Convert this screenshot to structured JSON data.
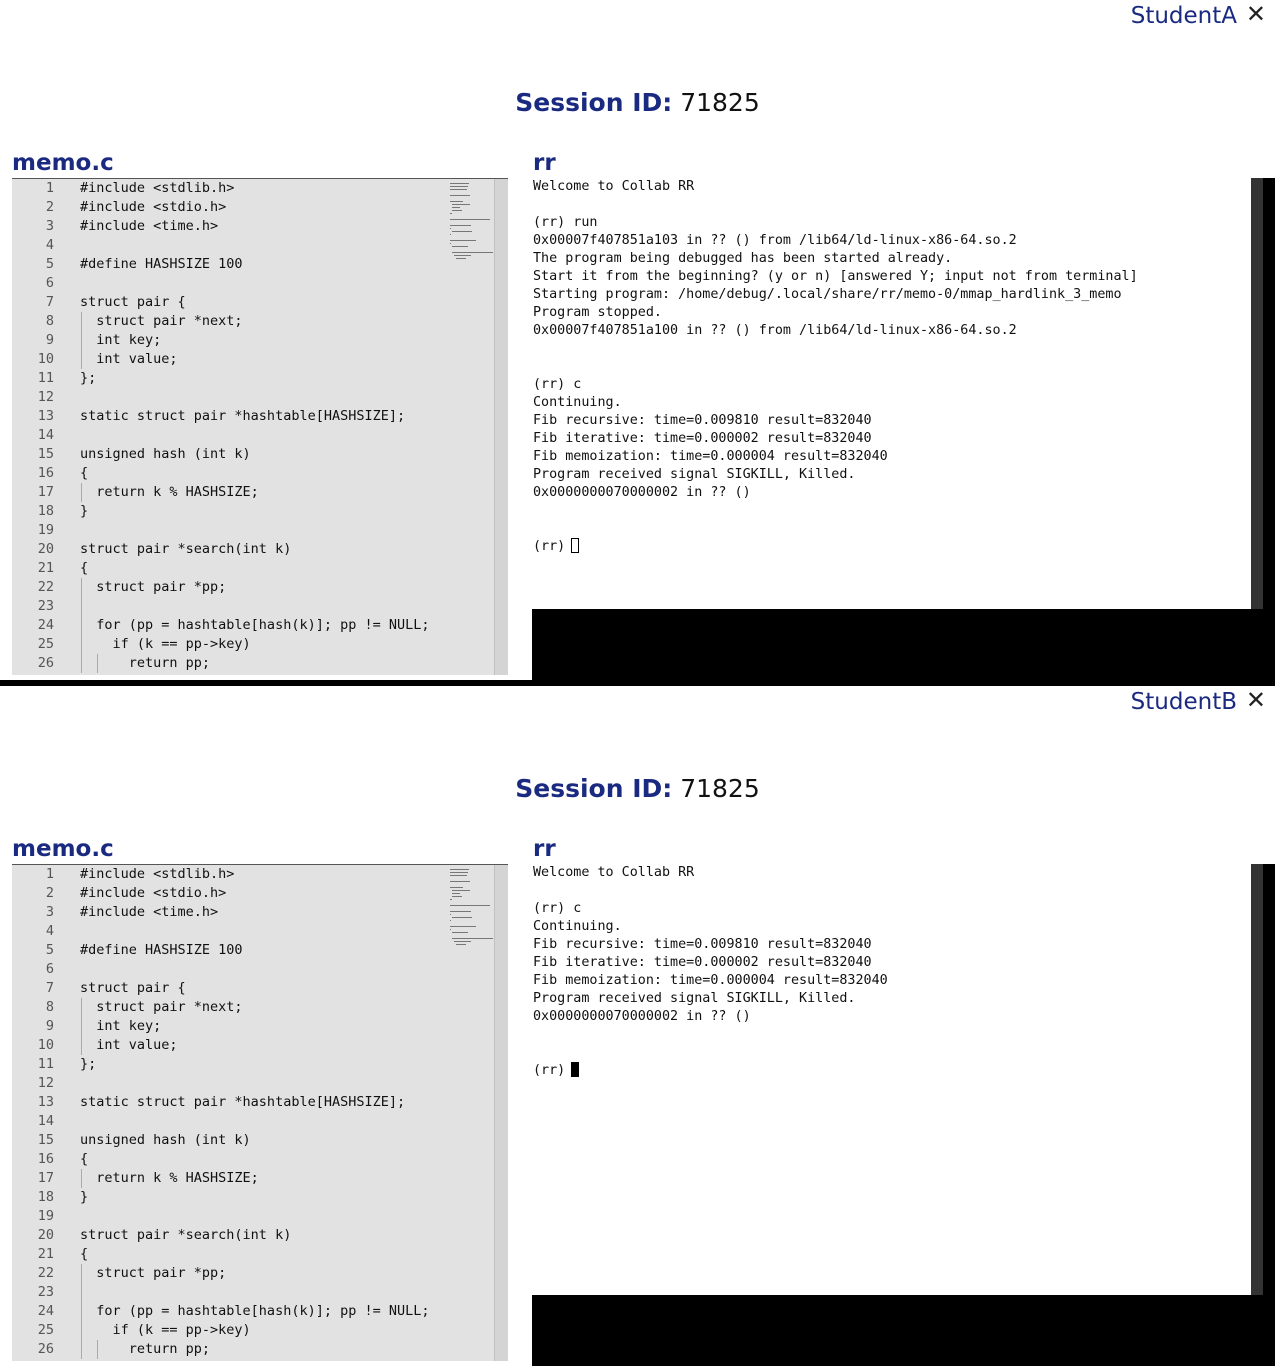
{
  "code_lines": [
    {
      "n": "1",
      "t": "#include <stdlib.h>",
      "g": 0
    },
    {
      "n": "2",
      "t": "#include <stdio.h>",
      "g": 0
    },
    {
      "n": "3",
      "t": "#include <time.h>",
      "g": 0
    },
    {
      "n": "4",
      "t": "",
      "g": 0
    },
    {
      "n": "5",
      "t": "#define HASHSIZE 100",
      "g": 0
    },
    {
      "n": "6",
      "t": "",
      "g": 0
    },
    {
      "n": "7",
      "t": "struct pair {",
      "g": 0
    },
    {
      "n": "8",
      "t": "  struct pair *next;",
      "g": 1
    },
    {
      "n": "9",
      "t": "  int key;",
      "g": 1
    },
    {
      "n": "10",
      "t": "  int value;",
      "g": 1
    },
    {
      "n": "11",
      "t": "};",
      "g": 0
    },
    {
      "n": "12",
      "t": "",
      "g": 0
    },
    {
      "n": "13",
      "t": "static struct pair *hashtable[HASHSIZE];",
      "g": 0
    },
    {
      "n": "14",
      "t": "",
      "g": 0
    },
    {
      "n": "15",
      "t": "unsigned hash (int k)",
      "g": 0
    },
    {
      "n": "16",
      "t": "{",
      "g": 0
    },
    {
      "n": "17",
      "t": "  return k % HASHSIZE;",
      "g": 1
    },
    {
      "n": "18",
      "t": "}",
      "g": 0
    },
    {
      "n": "19",
      "t": "",
      "g": 0
    },
    {
      "n": "20",
      "t": "struct pair *search(int k)",
      "g": 0
    },
    {
      "n": "21",
      "t": "{",
      "g": 0
    },
    {
      "n": "22",
      "t": "  struct pair *pp;",
      "g": 1
    },
    {
      "n": "23",
      "t": "",
      "g": 1
    },
    {
      "n": "24",
      "t": "  for (pp = hashtable[hash(k)]; pp != NULL;",
      "g": 1
    },
    {
      "n": "25",
      "t": "    if (k == pp->key)",
      "g": 1
    },
    {
      "n": "26",
      "t": "      return pp;",
      "g": 2
    }
  ],
  "panels": [
    {
      "user": "StudentA",
      "close": "✕",
      "session_label": "Session ID:",
      "session_id": "71825",
      "file_title": "memo.c",
      "terminal_title": "rr",
      "terminal_lines": [
        "Welcome to Collab RR",
        "",
        "(rr) run",
        "0x00007f407851a103 in ?? () from /lib64/ld-linux-x86-64.so.2",
        "The program being debugged has been started already.",
        "Start it from the beginning? (y or n) [answered Y; input not from terminal]",
        "Starting program: /home/debug/.local/share/rr/memo-0/mmap_hardlink_3_memo",
        "Program stopped.",
        "0x00007f407851a100 in ?? () from /lib64/ld-linux-x86-64.so.2",
        "",
        "",
        "(rr) c",
        "Continuing.",
        "Fib recursive: time=0.009810 result=832040",
        "Fib iterative: time=0.000002 result=832040",
        "Fib memoization: time=0.000004 result=832040",
        "Program received signal SIGKILL, Killed.",
        "0x0000000070000002 in ?? ()",
        "",
        ""
      ],
      "prompt": "(rr)",
      "cursor": "hollow"
    },
    {
      "user": "StudentB",
      "close": "✕",
      "session_label": "Session ID:",
      "session_id": "71825",
      "file_title": "memo.c",
      "terminal_title": "rr",
      "terminal_lines": [
        "Welcome to Collab RR",
        "",
        "(rr) c",
        "Continuing.",
        "Fib recursive: time=0.009810 result=832040",
        "Fib iterative: time=0.000002 result=832040",
        "Fib memoization: time=0.000004 result=832040",
        "Program received signal SIGKILL, Killed.",
        "0x0000000070000002 in ?? ()",
        "",
        ""
      ],
      "prompt": "(rr)",
      "cursor": "solid"
    }
  ]
}
